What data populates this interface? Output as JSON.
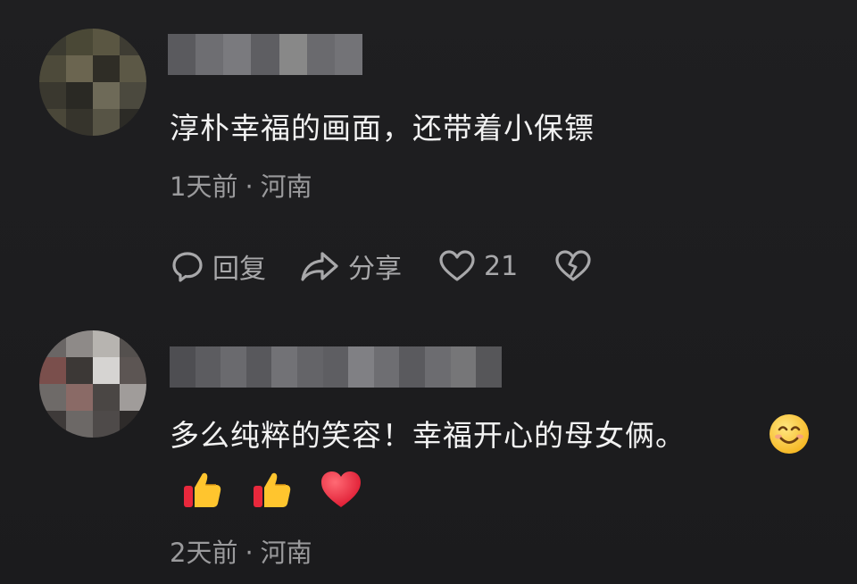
{
  "comments": [
    {
      "text": "淳朴幸福的画面，还带着小保镖",
      "time": "1天前",
      "location": "河南",
      "actions": {
        "reply": "回复",
        "share": "分享",
        "likes": "21"
      },
      "avatar_pixels": [
        "#3b3a30",
        "#4a4836",
        "#5a5642",
        "#3e3c33",
        "#4d4a3a",
        "#6b6550",
        "#2f2d26",
        "#5c5846",
        "#3a382f",
        "#2a2924",
        "#6e6a58",
        "#4b493e",
        "#4a4739",
        "#36342c",
        "#575445",
        "#2c2b26"
      ],
      "username_pixels": [
        "#5a5a5e",
        "#6e6e72",
        "#7a7a7e",
        "#5e5e62",
        "#888",
        "#6a6a6e",
        "#737377"
      ]
    },
    {
      "text": "多么纯粹的笑容！幸福开心的母女俩。",
      "emojis": [
        "smiling-face",
        "thumbs-up",
        "thumbs-up",
        "red-heart"
      ],
      "time": "2天前",
      "location": "河南",
      "avatar_pixels": [
        "#6a6665",
        "#8e8a88",
        "#b7b4b0",
        "#54504e",
        "#7a4f4c",
        "#3c3836",
        "#d6d4d2",
        "#5c5553",
        "#6e6a68",
        "#8a6a66",
        "#4a4644",
        "#a09c9a",
        "#3e3a39",
        "#6c6866",
        "#4e4a49",
        "#2e2b2a"
      ],
      "username_pixels": [
        "#4e4e52",
        "#5c5c60",
        "#6a6a6e",
        "#58585c",
        "#727276",
        "#646468",
        "#5e5e62",
        "#808084",
        "#6e6e72",
        "#5a5a5e",
        "#6c6c70",
        "#767678",
        "#565659"
      ]
    }
  ],
  "separator": "·",
  "colors": {
    "background": "#1d1d1f",
    "text": "#f2f2f2",
    "meta": "#9a9a9c",
    "action": "#a8a8aa",
    "heart_red": "#e8283c",
    "thumb_yellow": "#ffc52e",
    "emoji_face": "#ffcc3a"
  }
}
